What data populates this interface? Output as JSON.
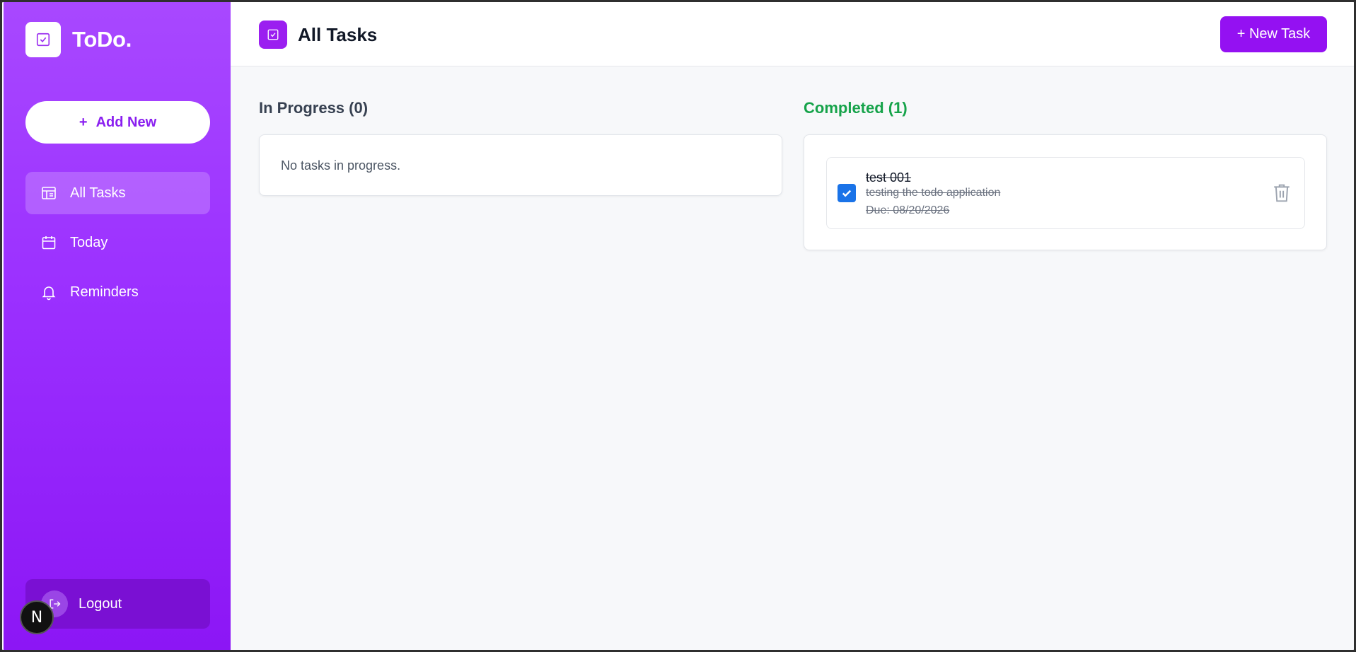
{
  "app": {
    "name": "ToDo."
  },
  "sidebar": {
    "add_new": {
      "icon": "plus-icon",
      "label": "Add New"
    },
    "items": [
      {
        "label": "All Tasks",
        "icon": "layout-icon",
        "active": true
      },
      {
        "label": "Today",
        "icon": "calendar-icon",
        "active": false
      },
      {
        "label": "Reminders",
        "icon": "bell-icon",
        "active": false
      }
    ],
    "logout": {
      "label": "Logout",
      "icon": "logout-icon"
    },
    "badge": "N"
  },
  "header": {
    "title": "All Tasks",
    "new_task_label": "+ New Task"
  },
  "columns": {
    "in_progress": {
      "title": "In Progress (0)",
      "empty_text": "No tasks in progress."
    },
    "completed": {
      "title": "Completed (1)",
      "tasks": [
        {
          "title": "test 001",
          "description": "testing the todo application",
          "due": "Due: 08/20/2026",
          "checked": true
        }
      ]
    }
  },
  "colors": {
    "accent": "#9411f2",
    "completed_title": "#16a34a",
    "checkbox": "#1a73e8"
  }
}
